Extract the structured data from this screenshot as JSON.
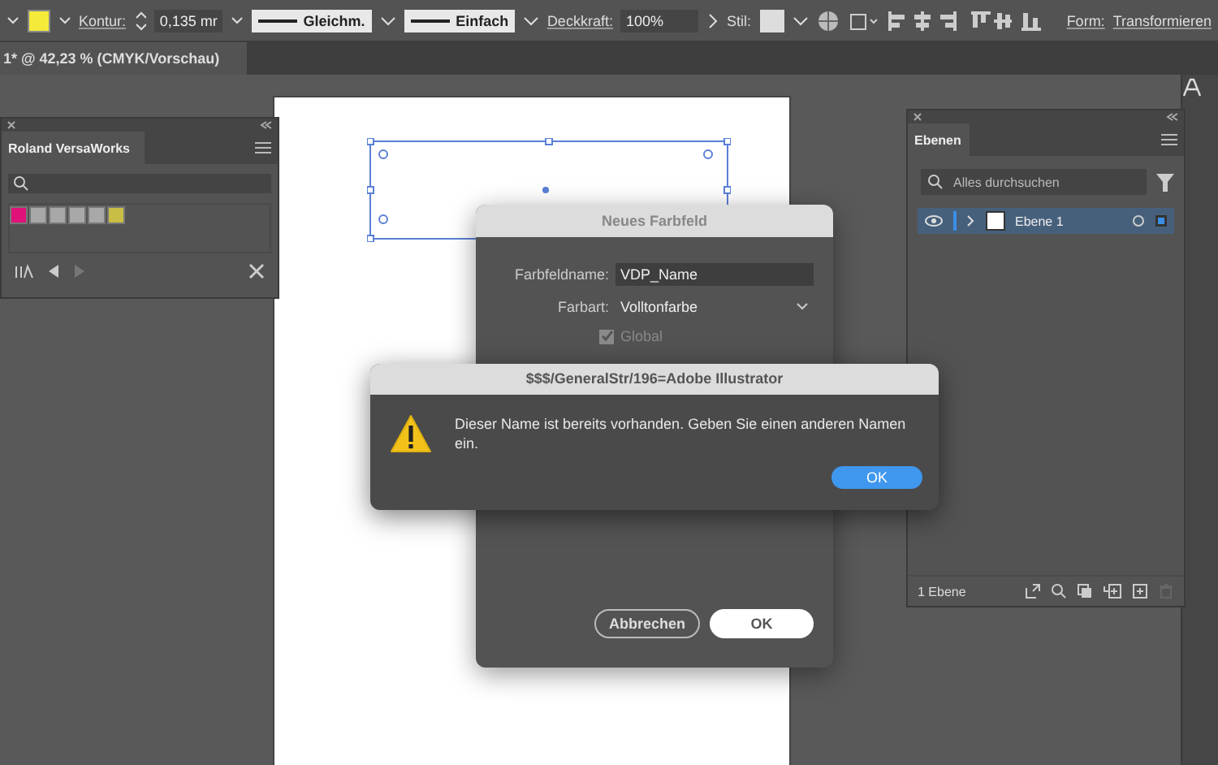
{
  "toolbar": {
    "stroke_label": "Kontur:",
    "stroke_value": "0,135 mr",
    "profile": "Gleichm.",
    "brush": "Einfach",
    "opacity_label": "Deckkraft:",
    "opacity_value": "100%",
    "style_label": "Stil:",
    "form_link": "Form:",
    "transform_link": "Transformieren"
  },
  "document_tab": {
    "title": "1* @ 42,23 % (CMYK/Vorschau)"
  },
  "swatches_panel": {
    "title": "Roland VersaWorks",
    "swatches": [
      {
        "color": "#e0127a"
      },
      {
        "color": "#a8a8a8"
      },
      {
        "color": "#a8a8a8"
      },
      {
        "color": "#a8a8a8"
      },
      {
        "color": "#a8a8a8"
      },
      {
        "color": "#c8be46"
      }
    ]
  },
  "layers_panel": {
    "title": "Ebenen",
    "search": {
      "placeholder": "Alles durchsuchen"
    },
    "layers": [
      {
        "name": "Ebene 1",
        "selected": true
      }
    ],
    "count": "1 Ebene"
  },
  "swatch_dialog": {
    "title": "Neues Farbfeld",
    "name_label": "Farbfeldname:",
    "name_value": "VDP_Name",
    "type_label": "Farbart:",
    "type_value": "Volltonfarbe",
    "global": {
      "label": "Global",
      "checked": true,
      "disabled": true
    },
    "buttons": [
      {
        "label": "Abbrechen",
        "kind": "secondary"
      },
      {
        "label": "OK",
        "kind": "primary"
      }
    ]
  },
  "alert": {
    "title": "$$$/GeneralStr/196=Adobe Illustrator",
    "message": "Dieser Name ist bereits vorhanden. Geben Sie einen anderen Namen ein.",
    "button": "OK"
  }
}
